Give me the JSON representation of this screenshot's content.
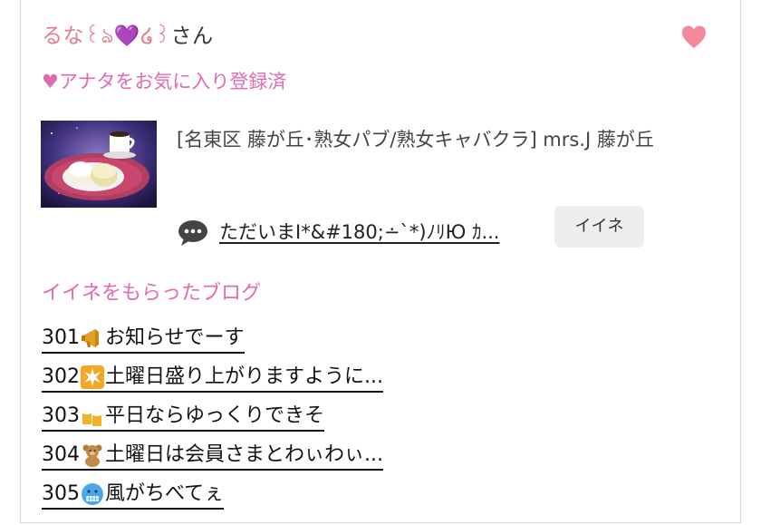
{
  "user": {
    "name": "るな꒰ঌ💜໒꒱",
    "suffix": "さん"
  },
  "favorite_status": "♥アナタをお気に入り登録済",
  "post": {
    "shop": "[名東区 藤が丘･熟女パブ/熟女キャバクラ]  mrs.J 藤が丘",
    "title": "ただいまI*&#180;∸`*)ﾉﾘЮ ｶ...",
    "iine_label": "イイネ"
  },
  "liked_blogs": {
    "heading": "イイネをもらったブログ",
    "items": [
      {
        "number": "301",
        "emoji": "megaphone-icon",
        "text": "お知らせでーす"
      },
      {
        "number": "302",
        "emoji": "sparkle-icon",
        "text": "土曜日盛り上がりますように..."
      },
      {
        "number": "303",
        "emoji": "beer-mugs-icon",
        "text": "平日ならゆっくりできそ"
      },
      {
        "number": "304",
        "emoji": "teddy-bear-icon",
        "text": "土曜日は会員さまとわぃわぃ..."
      },
      {
        "number": "305",
        "emoji": "cold-face-icon",
        "text": "風がちべてぇ"
      }
    ]
  },
  "colors": {
    "accent_pink": "#e26bb0",
    "name_pink": "#e47a8e",
    "heart": "#f28a9a"
  }
}
